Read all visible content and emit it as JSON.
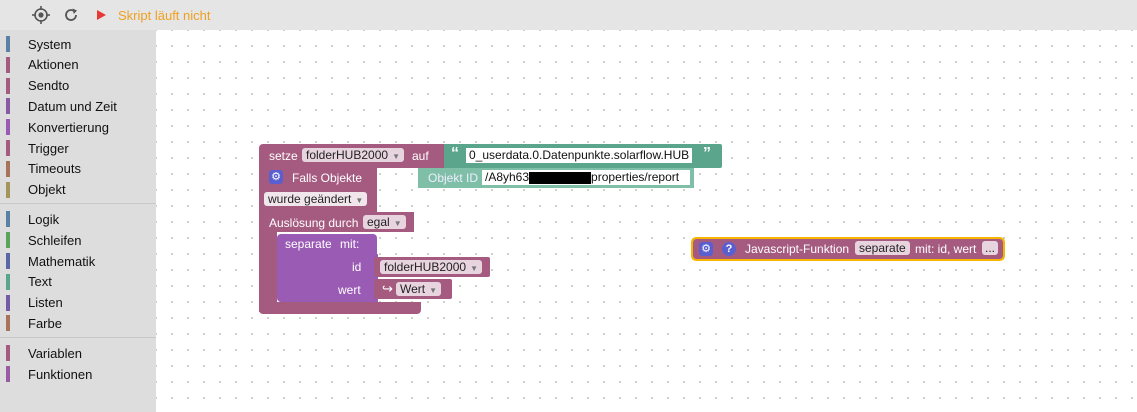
{
  "toolbar": {
    "target_icon": "crosshair-icon",
    "refresh_icon": "refresh-icon",
    "run_icon": "play-icon",
    "status": "Skript läuft nicht",
    "status_color": "#f0a020"
  },
  "sidebar": {
    "groups": [
      [
        {
          "label": "System",
          "color": "#5b80a5"
        },
        {
          "label": "Aktionen",
          "color": "#a55b80"
        },
        {
          "label": "Sendto",
          "color": "#a55b80"
        },
        {
          "label": "Datum und Zeit",
          "color": "#8a5ba5"
        },
        {
          "label": "Konvertierung",
          "color": "#9a5bb5"
        },
        {
          "label": "Trigger",
          "color": "#a55b80"
        },
        {
          "label": "Timeouts",
          "color": "#a5745b"
        },
        {
          "label": "Objekt",
          "color": "#a5955b"
        }
      ],
      [
        {
          "label": "Logik",
          "color": "#5b80a5"
        },
        {
          "label": "Schleifen",
          "color": "#5ba55b"
        },
        {
          "label": "Mathematik",
          "color": "#5b67a5"
        },
        {
          "label": "Text",
          "color": "#5ba58c"
        },
        {
          "label": "Listen",
          "color": "#745ba5"
        },
        {
          "label": "Farbe",
          "color": "#a5745b"
        }
      ],
      [
        {
          "label": "Variablen",
          "color": "#a55b80"
        },
        {
          "label": "Funktionen",
          "color": "#9a5ba5"
        }
      ]
    ]
  },
  "blocks": {
    "setze": {
      "keyword": "setze",
      "variable": "folderHUB2000",
      "auf": "auf",
      "open_quote": "“",
      "close_quote": "”",
      "string_value": "0_userdata.0.Datenpunkte.solarflow.HUB"
    },
    "trigger": {
      "title": "Falls Objekte",
      "objekt_id_label": "Objekt ID",
      "objekt_id_prefix": "/A8yh63",
      "objekt_id_suffix": "properties/report",
      "condition": "wurde geändert",
      "ausloesung_label": "Auslösung durch",
      "ausloesung_value": "egal"
    },
    "call": {
      "name": "separate",
      "mit": "mit:",
      "arg1_label": "id",
      "arg1_value": "folderHUB2000",
      "arg2_label": "wert",
      "arg2_value": "Wert"
    },
    "function_def": {
      "label": "Javascript-Funktion",
      "name": "separate",
      "params": "mit: id, wert",
      "more": "..."
    }
  }
}
